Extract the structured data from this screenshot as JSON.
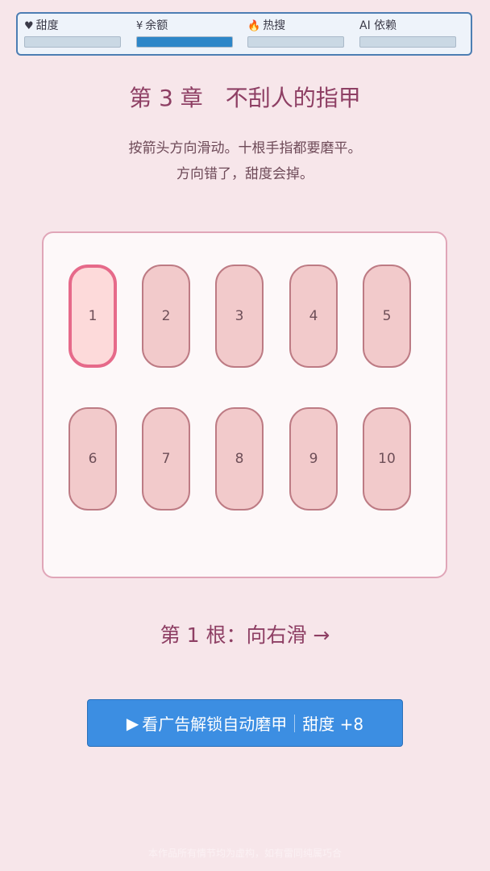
{
  "stats": [
    {
      "icon": "♥",
      "icon_name": "heart-icon",
      "label": "甜度",
      "fill": 0.0
    },
    {
      "icon": "¥",
      "icon_name": "yen-icon",
      "label": "余额",
      "fill": 1.0
    },
    {
      "icon": "🔥",
      "icon_name": "fire-icon",
      "label": "热搜",
      "fill": 0.0
    },
    {
      "icon": "",
      "icon_name": "",
      "label": "AI 依赖",
      "fill": 0.0
    }
  ],
  "chapter_title": "第 3 章　不刮人的指甲",
  "instructions": [
    "按箭头方向滑动。十根手指都要磨平。",
    "方向错了，甜度会掉。"
  ],
  "nails": [
    "1",
    "2",
    "3",
    "4",
    "5",
    "6",
    "7",
    "8",
    "9",
    "10"
  ],
  "active_nail": 1,
  "prompt": "第 1 根：向右滑 →",
  "ad_button": {
    "icon": "▶",
    "label": "看广告解锁自动磨甲",
    "bonus": "甜度 +8"
  },
  "footer": "本作品所有情节均为虚构，如有雷同纯属巧合",
  "colors": {
    "background": "#f7e6ea",
    "accent": "#8e3f64",
    "stat_fill": "#2d86c8",
    "nail": "#f2cacb",
    "nail_active_border": "#e66a8a",
    "button": "#3c8ee2"
  }
}
